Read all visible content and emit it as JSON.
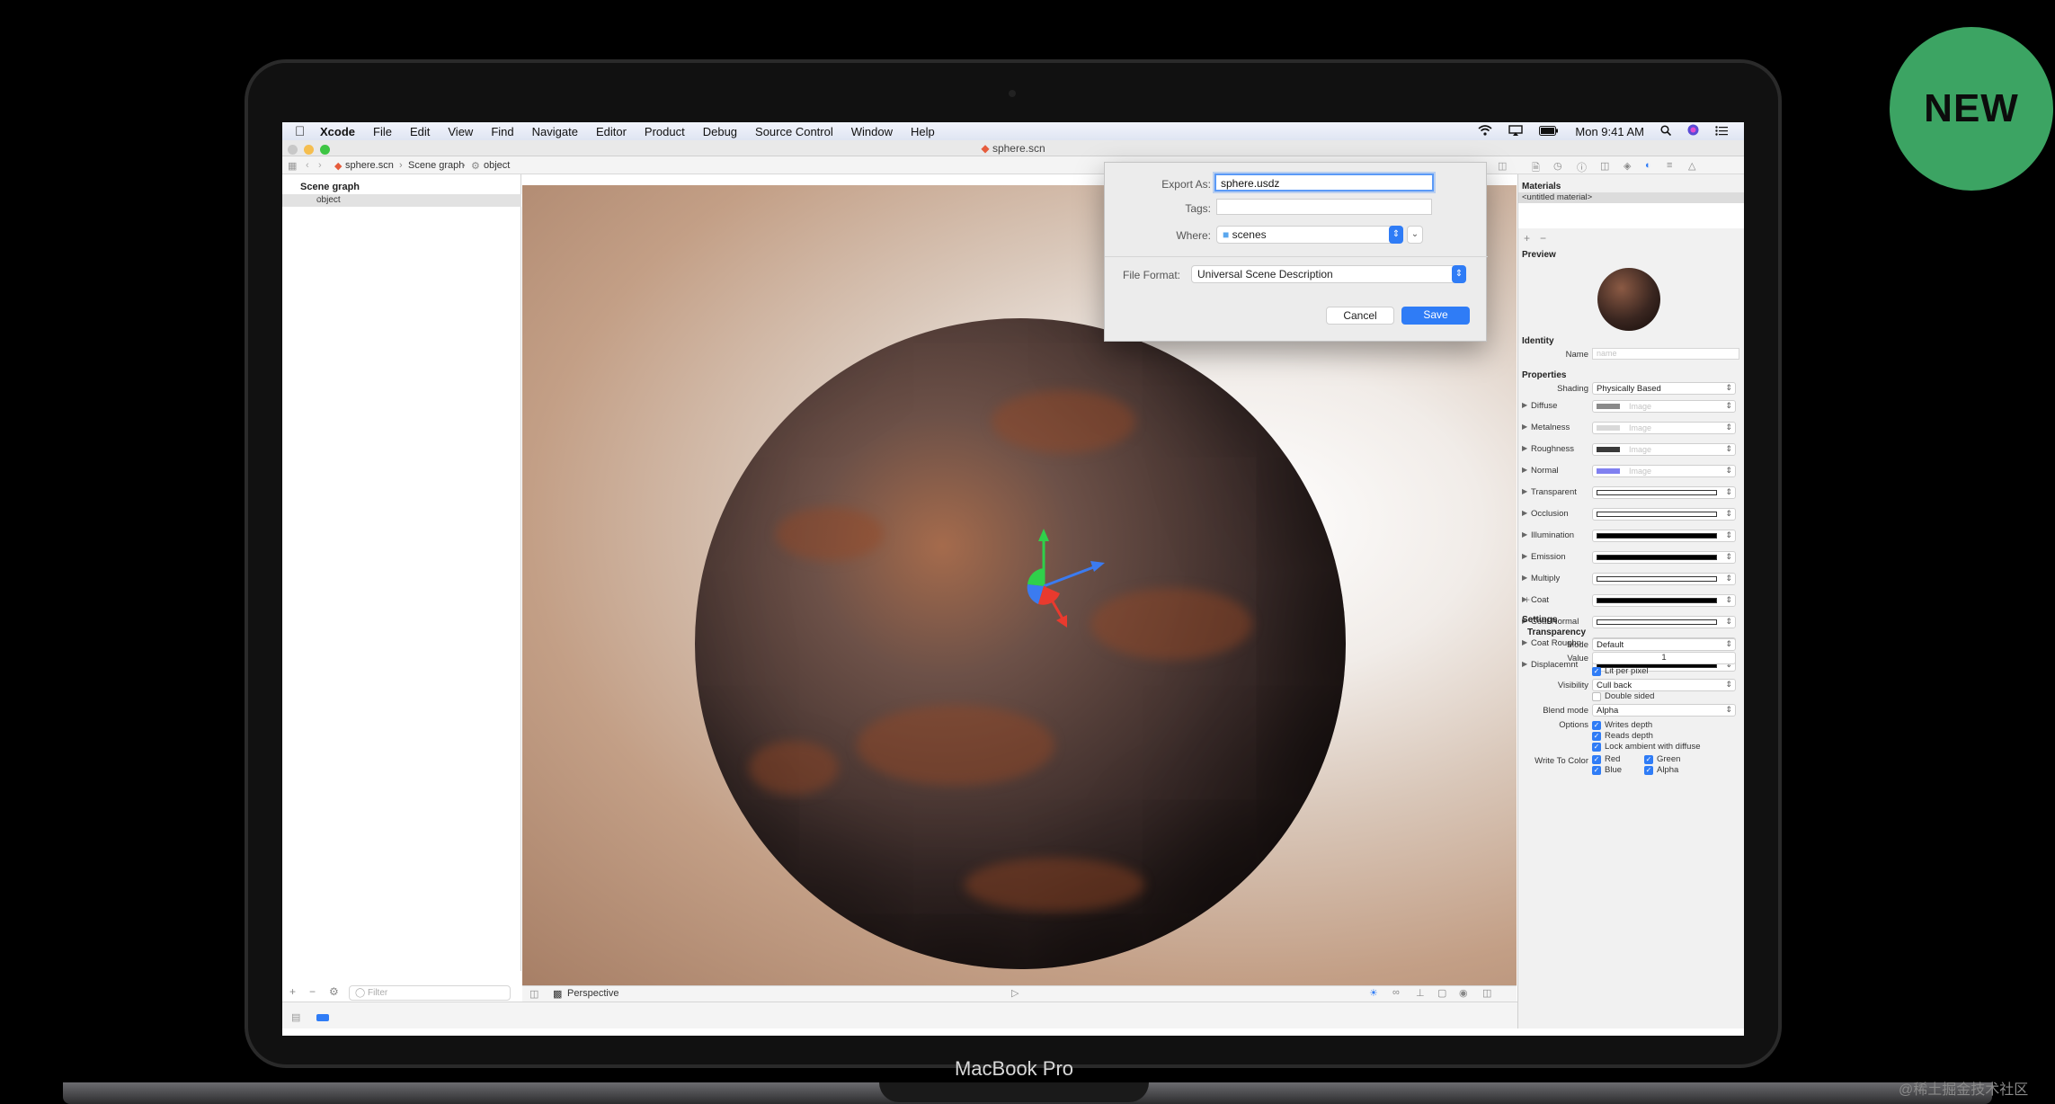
{
  "badge": "NEW",
  "laptop_label": "MacBook Pro",
  "watermark": "@稀土掘金技术社区",
  "menubar": {
    "app": "Xcode",
    "items": [
      "File",
      "Edit",
      "View",
      "Find",
      "Navigate",
      "Editor",
      "Product",
      "Debug",
      "Source Control",
      "Window",
      "Help"
    ],
    "clock": "Mon 9:41 AM"
  },
  "window": {
    "title": "sphere.scn"
  },
  "breadcrumb": {
    "file": "sphere.scn",
    "graph": "Scene graph",
    "node": "object"
  },
  "navigator": {
    "heading": "Scene graph",
    "selected_item": "object",
    "filter_placeholder": "Filter"
  },
  "viewport": {
    "camera": "Perspective"
  },
  "dialog": {
    "export_label": "Export As:",
    "export_value": "sphere.usdz",
    "tags_label": "Tags:",
    "tags_value": "",
    "where_label": "Where:",
    "where_value": "scenes",
    "format_label": "File Format:",
    "format_value": "Universal Scene Description",
    "cancel": "Cancel",
    "save": "Save"
  },
  "inspector": {
    "materials_heading": "Materials",
    "material_item": "<untitled material>",
    "preview_heading": "Preview",
    "identity_heading": "Identity",
    "name_label": "Name",
    "name_placeholder": "name",
    "properties_heading": "Properties",
    "shading_label": "Shading",
    "shading_value": "Physically Based",
    "image_placeholder": "Image",
    "props": [
      {
        "label": "Diffuse",
        "kind": "image",
        "color": "#8a8a8a"
      },
      {
        "label": "Metalness",
        "kind": "image",
        "color": "#d9d9d9"
      },
      {
        "label": "Roughness",
        "kind": "image",
        "color": "#3a3a3a"
      },
      {
        "label": "Normal",
        "kind": "image",
        "color": "#8080f0"
      },
      {
        "label": "Transparent",
        "kind": "bar",
        "color": "#ffffff"
      },
      {
        "label": "Occlusion",
        "kind": "bar",
        "color": "#ffffff"
      },
      {
        "label": "Illumination",
        "kind": "bar",
        "color": "#000000"
      },
      {
        "label": "Emission",
        "kind": "bar",
        "color": "#000000"
      },
      {
        "label": "Multiply",
        "kind": "bar",
        "color": "#ffffff"
      },
      {
        "label": "Coat",
        "kind": "bar",
        "color": "#000000"
      },
      {
        "label": "Coat Normal",
        "kind": "bar",
        "color": "#ffffff"
      },
      {
        "label": "Coat Roughn",
        "kind": "bar",
        "color": "#000000"
      },
      {
        "label": "Displacemnt",
        "kind": "bar",
        "color": "#000000"
      }
    ],
    "settings_heading": "Settings",
    "transparency_heading": "Transparency",
    "mode_label": "Mode",
    "mode_value": "Default",
    "value_label": "Value",
    "value_value": "1",
    "lit_per_pixel": "Lit per pixel",
    "visibility_label": "Visibility",
    "visibility_value": "Cull back",
    "double_sided": "Double sided",
    "blend_label": "Blend mode",
    "blend_value": "Alpha",
    "options_label": "Options",
    "writes_depth": "Writes depth",
    "reads_depth": "Reads depth",
    "lock_ambient": "Lock ambient with diffuse",
    "write_color_label": "Write To Color",
    "red": "Red",
    "green": "Green",
    "blue": "Blue",
    "alpha": "Alpha"
  },
  "colors": {
    "accent": "#2f7cf6",
    "badge": "#3ca463"
  }
}
